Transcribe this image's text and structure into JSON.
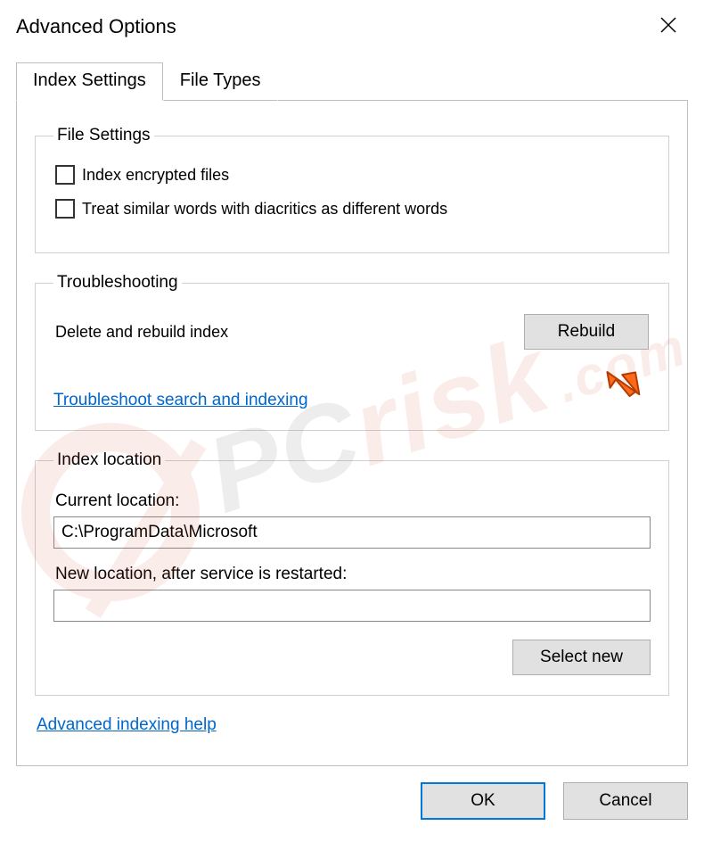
{
  "window": {
    "title": "Advanced Options"
  },
  "tabs": {
    "index_settings": "Index Settings",
    "file_types": "File Types"
  },
  "file_settings": {
    "legend": "File Settings",
    "index_encrypted": "Index encrypted files",
    "diacritics": "Treat similar words with diacritics as different words"
  },
  "troubleshooting": {
    "legend": "Troubleshooting",
    "delete_rebuild": "Delete and rebuild index",
    "rebuild_btn": "Rebuild",
    "troubleshoot_link": "Troubleshoot search and indexing"
  },
  "index_location": {
    "legend": "Index location",
    "current_label": "Current location:",
    "current_value": "C:\\ProgramData\\Microsoft",
    "new_label": "New location, after service is restarted:",
    "new_value": "",
    "select_new_btn": "Select new"
  },
  "advanced_help_link": "Advanced indexing help",
  "footer": {
    "ok": "OK",
    "cancel": "Cancel"
  },
  "watermark": {
    "part1": "PC",
    "part2": "risk",
    "suffix": ".com"
  }
}
